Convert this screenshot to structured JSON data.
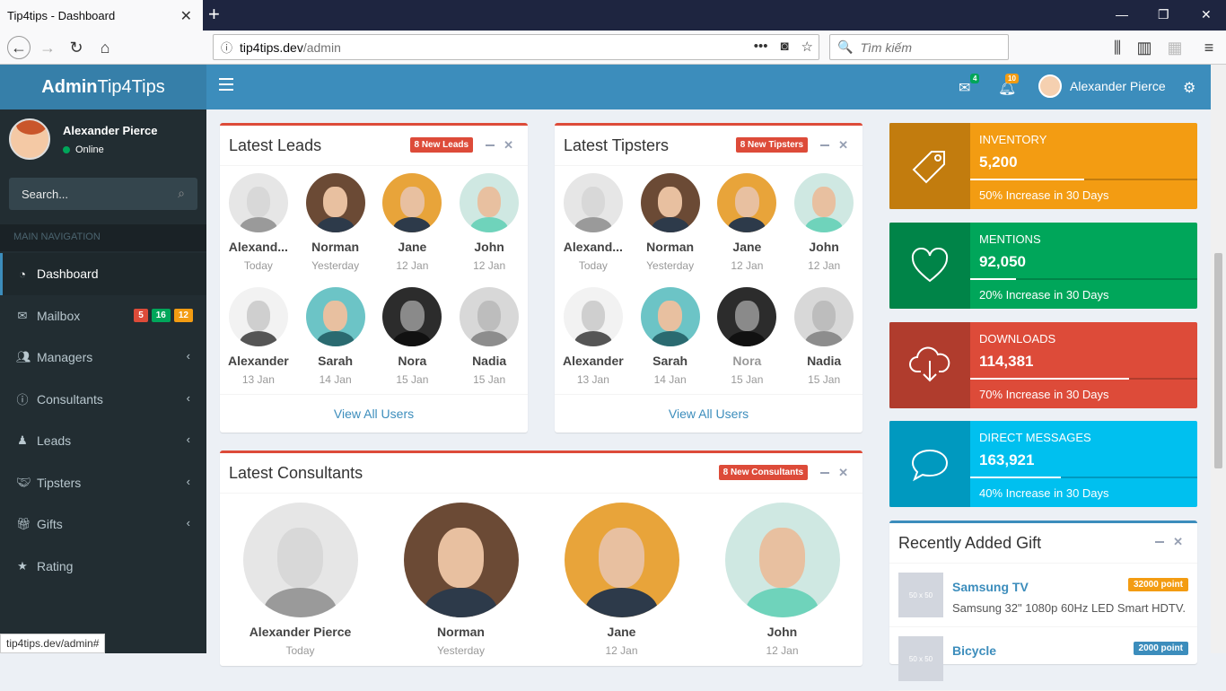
{
  "browser": {
    "tab_title": "Tip4tips - Dashboard",
    "url_host": "tip4tips.dev",
    "url_path": "/admin",
    "search_placeholder": "Tìm kiếm",
    "status_url": "tip4tips.dev/admin#"
  },
  "app": {
    "logo_bold": "Admin",
    "logo_rest": "Tip4Tips",
    "messages_count": "4",
    "notifications_count": "10",
    "user_name": "Alexander Pierce"
  },
  "sidebar": {
    "user_name": "Alexander Pierce",
    "status": "Online",
    "search_placeholder": "Search...",
    "nav_header": "MAIN NAVIGATION",
    "items": [
      {
        "label": "Dashboard",
        "icon": "dashboard-icon"
      },
      {
        "label": "Mailbox",
        "icon": "envelope-icon",
        "badges": [
          "5",
          "16",
          "12"
        ]
      },
      {
        "label": "Managers",
        "icon": "users-icon"
      },
      {
        "label": "Consultants",
        "icon": "info-icon"
      },
      {
        "label": "Leads",
        "icon": "person-icon"
      },
      {
        "label": "Tipsters",
        "icon": "handshake-icon"
      },
      {
        "label": "Gifts",
        "icon": "gift-icon"
      },
      {
        "label": "Rating",
        "icon": "star-icon"
      }
    ]
  },
  "leads": {
    "title": "Latest Leads",
    "badge": "8 New Leads",
    "footer": "View All Users",
    "users": [
      {
        "name": "Alexand...",
        "date": "Today"
      },
      {
        "name": "Norman",
        "date": "Yesterday"
      },
      {
        "name": "Jane",
        "date": "12 Jan"
      },
      {
        "name": "John",
        "date": "12 Jan"
      },
      {
        "name": "Alexander",
        "date": "13 Jan"
      },
      {
        "name": "Sarah",
        "date": "14 Jan"
      },
      {
        "name": "Nora",
        "date": "15 Jan"
      },
      {
        "name": "Nadia",
        "date": "15 Jan"
      }
    ]
  },
  "tipsters": {
    "title": "Latest Tipsters",
    "badge": "8 New Tipsters",
    "footer": "View All Users",
    "users": [
      {
        "name": "Alexand...",
        "date": "Today"
      },
      {
        "name": "Norman",
        "date": "Yesterday"
      },
      {
        "name": "Jane",
        "date": "12 Jan"
      },
      {
        "name": "John",
        "date": "12 Jan"
      },
      {
        "name": "Alexander",
        "date": "13 Jan"
      },
      {
        "name": "Sarah",
        "date": "14 Jan"
      },
      {
        "name": "Nora",
        "date": "15 Jan"
      },
      {
        "name": "Nadia",
        "date": "15 Jan"
      }
    ]
  },
  "consultants": {
    "title": "Latest Consultants",
    "badge": "8 New Consultants",
    "users": [
      {
        "name": "Alexander Pierce",
        "date": "Today"
      },
      {
        "name": "Norman",
        "date": "Yesterday"
      },
      {
        "name": "Jane",
        "date": "12 Jan"
      },
      {
        "name": "John",
        "date": "12 Jan"
      }
    ]
  },
  "stats": [
    {
      "title": "Inventory",
      "value": "5,200",
      "desc": "50% Increase in 30 Days",
      "progress": 0.5,
      "color": "#f39c12",
      "icon": "tag-icon"
    },
    {
      "title": "Mentions",
      "value": "92,050",
      "desc": "20% Increase in 30 Days",
      "progress": 0.2,
      "color": "#00a65a",
      "icon": "heart-icon"
    },
    {
      "title": "Downloads",
      "value": "114,381",
      "desc": "70% Increase in 30 Days",
      "progress": 0.7,
      "color": "#dd4b39",
      "icon": "cloud-download-icon"
    },
    {
      "title": "Direct Messages",
      "value": "163,921",
      "desc": "40% Increase in 30 Days",
      "progress": 0.4,
      "color": "#00c0ef",
      "icon": "chat-icon"
    }
  ],
  "gifts": {
    "title": "Recently Added Gift",
    "items": [
      {
        "name": "Samsung TV",
        "desc": "Samsung 32\" 1080p 60Hz LED Smart HDTV.",
        "points": "32000 point",
        "thumb": "50 x 50"
      },
      {
        "name": "Bicycle",
        "desc": "",
        "points": "2000 point",
        "thumb": "50 x 50"
      }
    ]
  }
}
